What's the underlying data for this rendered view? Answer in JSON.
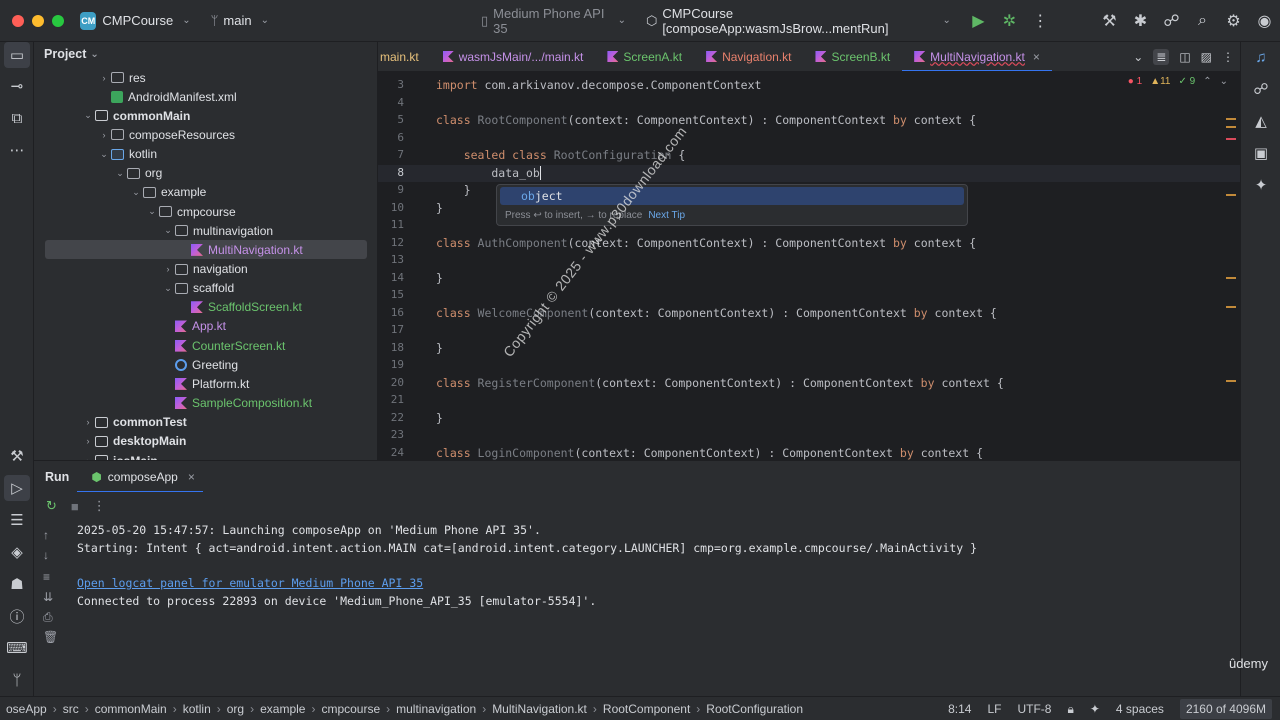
{
  "titlebar": {
    "project_badge": "CM",
    "project_name": "CMPCourse",
    "branch": "main",
    "device": "Medium Phone API 35",
    "run_config": "CMPCourse [composeApp:wasmJsBrow...mentRun]"
  },
  "project_panel": {
    "title": "Project",
    "tree": [
      {
        "label": "res",
        "kind": "folder",
        "arrow": "›",
        "indent": 4
      },
      {
        "label": "AndroidManifest.xml",
        "kind": "xml",
        "arrow": "",
        "indent": 4
      },
      {
        "label": "commonMain",
        "kind": "folder-bold",
        "arrow": "⌄",
        "indent": 3
      },
      {
        "label": "composeResources",
        "kind": "folder",
        "arrow": "›",
        "indent": 4
      },
      {
        "label": "kotlin",
        "kind": "folder-blue",
        "arrow": "⌄",
        "indent": 4
      },
      {
        "label": "org",
        "kind": "folder",
        "arrow": "⌄",
        "indent": 5
      },
      {
        "label": "example",
        "kind": "folder",
        "arrow": "⌄",
        "indent": 6
      },
      {
        "label": "cmpcourse",
        "kind": "folder",
        "arrow": "⌄",
        "indent": 7
      },
      {
        "label": "multinavigation",
        "kind": "folder",
        "arrow": "⌄",
        "indent": 8
      },
      {
        "label": "MultiNavigation.kt",
        "kind": "kt-pink",
        "arrow": "",
        "indent": 9,
        "selected": true
      },
      {
        "label": "navigation",
        "kind": "folder",
        "arrow": "›",
        "indent": 8
      },
      {
        "label": "scaffold",
        "kind": "folder",
        "arrow": "⌄",
        "indent": 8
      },
      {
        "label": "ScaffoldScreen.kt",
        "kind": "kt-green",
        "arrow": "",
        "indent": 9
      },
      {
        "label": "App.kt",
        "kind": "kt-pink",
        "arrow": "",
        "indent": 8
      },
      {
        "label": "CounterScreen.kt",
        "kind": "kt-green",
        "arrow": "",
        "indent": 8
      },
      {
        "label": "Greeting",
        "kind": "class",
        "arrow": "",
        "indent": 8
      },
      {
        "label": "Platform.kt",
        "kind": "kt",
        "arrow": "",
        "indent": 8
      },
      {
        "label": "SampleComposition.kt",
        "kind": "kt-green",
        "arrow": "",
        "indent": 8
      },
      {
        "label": "commonTest",
        "kind": "folder-bold",
        "arrow": "›",
        "indent": 3
      },
      {
        "label": "desktopMain",
        "kind": "folder-bold",
        "arrow": "›",
        "indent": 3
      },
      {
        "label": "iosMain",
        "kind": "folder-bold",
        "arrow": "›",
        "indent": 3
      }
    ]
  },
  "tabs": [
    {
      "label": "main.kt",
      "color": "yellow"
    },
    {
      "label": "wasmJsMain/.../main.kt",
      "color": "pink"
    },
    {
      "label": "ScreenA.kt",
      "color": "green"
    },
    {
      "label": "Navigation.kt",
      "color": "red"
    },
    {
      "label": "ScreenB.kt",
      "color": "green"
    },
    {
      "label": "MultiNavigation.kt",
      "color": "pink",
      "active": true
    }
  ],
  "editor": {
    "errors": "1",
    "warnings": "11",
    "weak_warnings": "9",
    "lines": [
      {
        "num": "3",
        "parts": [
          [
            "kw",
            "import "
          ],
          [
            "cls",
            "com.arkivanov.decompose.ComponentContext"
          ]
        ]
      },
      {
        "num": "4",
        "parts": []
      },
      {
        "num": "5",
        "parts": [
          [
            "kw",
            "class "
          ],
          [
            "dim",
            "RootComponent"
          ],
          [
            "cls",
            "(context: ComponentContext) : ComponentContext "
          ],
          [
            "kw",
            "by "
          ],
          [
            "cls",
            "context {"
          ]
        ]
      },
      {
        "num": "6",
        "parts": []
      },
      {
        "num": "7",
        "parts": [
          [
            "cls",
            "    "
          ],
          [
            "kw",
            "sealed class "
          ],
          [
            "dim",
            "RootConfiguration"
          ],
          [
            "cls",
            " {"
          ]
        ]
      },
      {
        "num": "8",
        "parts": [
          [
            "cls",
            "        data_ob"
          ]
        ],
        "current": true
      },
      {
        "num": "9",
        "parts": [
          [
            "cls",
            "    }"
          ]
        ]
      },
      {
        "num": "10",
        "parts": [
          [
            "cls",
            "}"
          ]
        ]
      },
      {
        "num": "11",
        "parts": []
      },
      {
        "num": "12",
        "parts": [
          [
            "kw",
            "class "
          ],
          [
            "dim",
            "AuthComponent"
          ],
          [
            "cls",
            "(context: ComponentContext) : ComponentContext "
          ],
          [
            "kw",
            "by "
          ],
          [
            "cls",
            "context {"
          ]
        ]
      },
      {
        "num": "13",
        "parts": []
      },
      {
        "num": "14",
        "parts": [
          [
            "cls",
            "}"
          ]
        ]
      },
      {
        "num": "15",
        "parts": []
      },
      {
        "num": "16",
        "parts": [
          [
            "kw",
            "class "
          ],
          [
            "dim",
            "WelcomeComponent"
          ],
          [
            "cls",
            "(context: ComponentContext) : ComponentContext "
          ],
          [
            "kw",
            "by "
          ],
          [
            "cls",
            "context {"
          ]
        ]
      },
      {
        "num": "17",
        "parts": []
      },
      {
        "num": "18",
        "parts": [
          [
            "cls",
            "}"
          ]
        ]
      },
      {
        "num": "19",
        "parts": []
      },
      {
        "num": "20",
        "parts": [
          [
            "kw",
            "class "
          ],
          [
            "dim",
            "RegisterComponent"
          ],
          [
            "cls",
            "(context: ComponentContext) : ComponentContext "
          ],
          [
            "kw",
            "by "
          ],
          [
            "cls",
            "context {"
          ]
        ]
      },
      {
        "num": "21",
        "parts": []
      },
      {
        "num": "22",
        "parts": [
          [
            "cls",
            "}"
          ]
        ]
      },
      {
        "num": "23",
        "parts": []
      },
      {
        "num": "24",
        "parts": [
          [
            "kw",
            "class "
          ],
          [
            "dim",
            "LoginComponent"
          ],
          [
            "cls",
            "(context: ComponentContext) : ComponentContext "
          ],
          [
            "kw",
            "by "
          ],
          [
            "cls",
            "context {"
          ]
        ]
      }
    ]
  },
  "completion": {
    "match": "ob",
    "rest": "ject",
    "hint": "Press ↩ to insert, → to replace",
    "next_tip": "Next Tip"
  },
  "watermark": "Copyright © 2025 - www.p30download.com",
  "run_panel": {
    "title": "Run",
    "tab_label": "composeApp",
    "console": [
      {
        "text": "2025-05-20 15:47:57: Launching composeApp on 'Medium Phone API 35'.",
        "link": false
      },
      {
        "text": "Starting: Intent { act=android.intent.action.MAIN cat=[android.intent.category.LAUNCHER] cmp=org.example.cmpcourse/.MainActivity }",
        "link": false
      },
      {
        "text": "",
        "link": false
      },
      {
        "text": "Open logcat panel for emulator Medium Phone API 35",
        "link": true
      },
      {
        "text": "Connected to process 22893 on device 'Medium_Phone_API_35 [emulator-5554]'.",
        "link": false
      }
    ]
  },
  "statusbar": {
    "breadcrumbs": [
      "oseApp",
      "src",
      "commonMain",
      "kotlin",
      "org",
      "example",
      "cmpcourse",
      "multinavigation",
      "MultiNavigation.kt",
      "RootComponent",
      "RootConfiguration"
    ],
    "position": "8:14",
    "line_ending": "LF",
    "encoding": "UTF-8",
    "indent": "4 spaces",
    "lines": "2160 of 4096M"
  },
  "udemy": "ûdemy"
}
